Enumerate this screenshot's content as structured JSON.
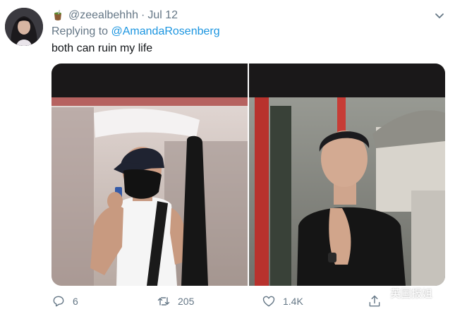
{
  "tweet": {
    "username": "@zeealbehhh",
    "separator": "·",
    "date": "Jul 12",
    "header_emoji": "mate-cup-icon",
    "replying_prefix": "Replying to ",
    "replying_to": "@AmandaRosenberg",
    "text": "both can ruin my life"
  },
  "media": {
    "left_image": "man-with-guitar-case-photo",
    "right_image": "man-in-black-suit-praying-photo"
  },
  "actions": {
    "reply_count": "6",
    "retweet_count": "205",
    "like_count": "1.4K"
  },
  "watermark": {
    "text": "英国报姐"
  },
  "colors": {
    "link": "#1b95e0",
    "muted": "#657786",
    "text": "#14171a"
  }
}
